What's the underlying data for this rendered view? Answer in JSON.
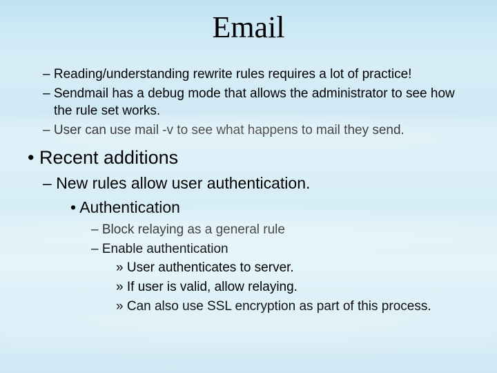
{
  "title": "Email",
  "intro": {
    "i0": "Reading/understanding rewrite rules requires a lot of practice!",
    "i1": "Sendmail has a debug mode that allows the administrator to see how the rule set works.",
    "i2": "User can use mail -v to see what happens to mail they send."
  },
  "recent": {
    "heading": "Recent additions",
    "r0": "New rules allow user authentication.",
    "auth": {
      "heading": "Authentication",
      "a0": "Block relaying as a general rule",
      "a1": "Enable authentication",
      "sub": {
        "s0": "User authenticates to server.",
        "s1": "If user is valid, allow relaying.",
        "s2": "Can also use SSL encryption as part of this process."
      }
    }
  }
}
